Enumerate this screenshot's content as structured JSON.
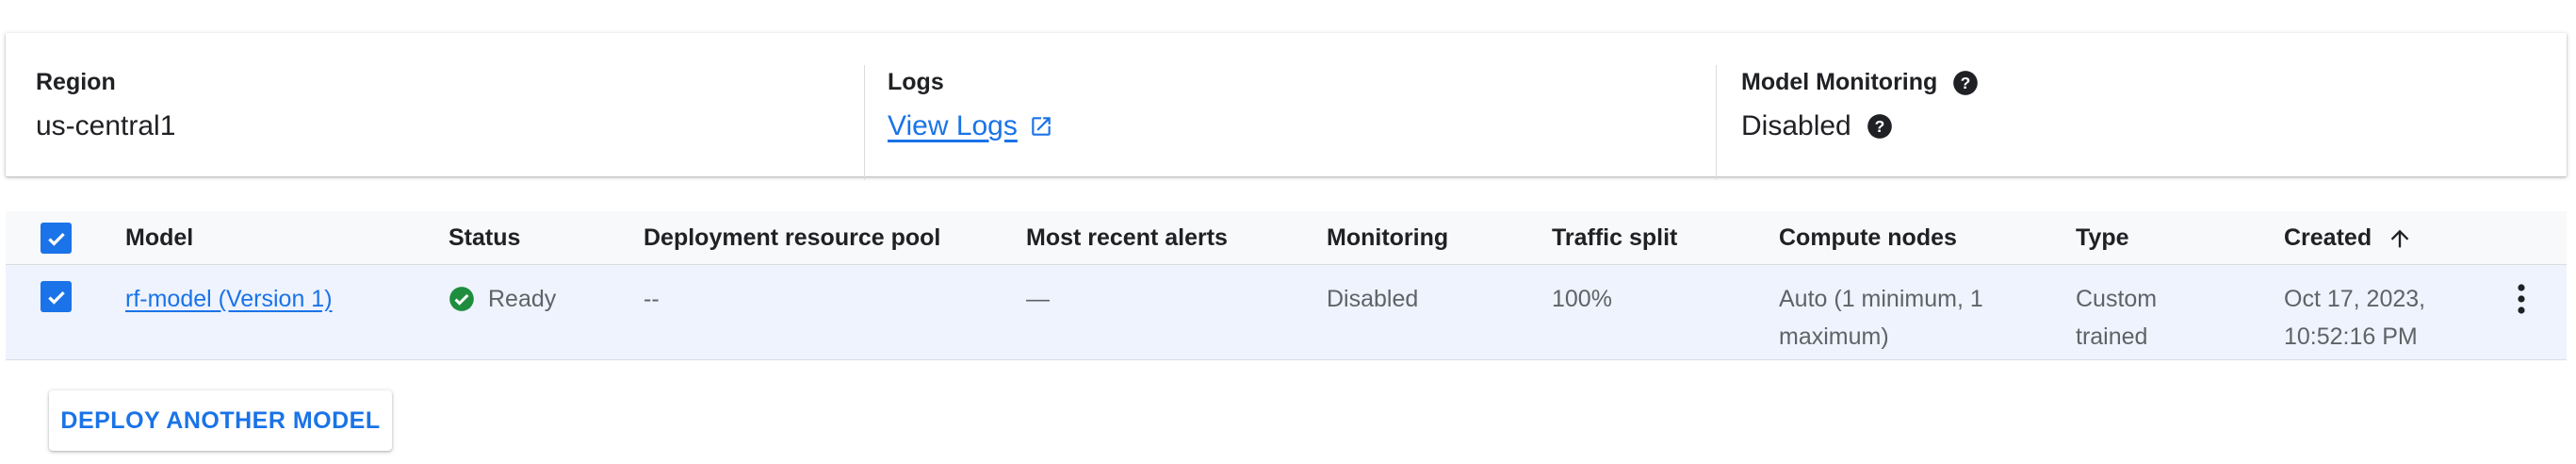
{
  "info": {
    "region": {
      "label": "Region",
      "value": "us-central1"
    },
    "logs": {
      "label": "Logs",
      "link_text": "View Logs"
    },
    "monitoring": {
      "label": "Model Monitoring",
      "value": "Disabled"
    }
  },
  "table": {
    "columns": {
      "model": "Model",
      "status": "Status",
      "pool": "Deployment resource pool",
      "alerts": "Most recent alerts",
      "monitoring": "Monitoring",
      "traffic": "Traffic split",
      "compute": "Compute nodes",
      "type": "Type",
      "created": "Created"
    },
    "rows": [
      {
        "model": "rf-model (Version 1)",
        "status": "Ready",
        "pool": "--",
        "alerts": "—",
        "monitoring": "Disabled",
        "traffic": "100%",
        "compute_line1": "Auto (1 minimum, 1",
        "compute_line2": "maximum)",
        "type_line1": "Custom",
        "type_line2": "trained",
        "created_line1": "Oct 17, 2023,",
        "created_line2": "10:52:16 PM"
      }
    ]
  },
  "actions": {
    "deploy_another": "DEPLOY ANOTHER MODEL"
  },
  "colors": {
    "accent": "#1a73e8",
    "ready": "#1e8e3e",
    "row_selected": "#eef3fd",
    "header_bg": "#f8f9fa"
  },
  "icons": [
    "help-icon",
    "external-link-icon",
    "checkbox-checked-icon",
    "check-circle-icon",
    "arrow-up-icon",
    "more-vert-icon"
  ]
}
